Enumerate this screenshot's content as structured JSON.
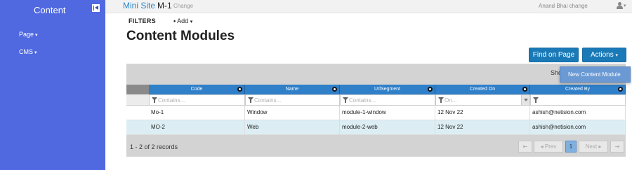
{
  "sidebar": {
    "title": "Content",
    "items": [
      {
        "label": "Page"
      },
      {
        "label": "CMS"
      }
    ]
  },
  "topbar": {
    "site_label": "Mini Site",
    "site_name": "M-1",
    "change_label": "Change",
    "user_label": "Anand Bhai change"
  },
  "filters": {
    "label": "FILTERS",
    "add_label": "Add"
  },
  "main": {
    "title": "Content Modules",
    "find_button": "Find on Page",
    "actions_button": "Actions",
    "actions_menu": [
      {
        "label": "New Content Module"
      }
    ]
  },
  "grid": {
    "toolbar_text": "Sho",
    "columns": [
      "Code",
      "Name",
      "UrlSegment",
      "Created On",
      "Created By"
    ],
    "filter_placeholders": [
      "Contains...",
      "Contains...",
      "Contains...",
      "On...",
      ""
    ],
    "rows": [
      [
        "Mo-1",
        "Window",
        "module-1-window",
        "12 Nov 22",
        "ashish@netision.com"
      ],
      [
        "MO-2",
        "Web",
        "module-2-web",
        "12 Nov 22",
        "ashish@netision.com"
      ]
    ],
    "pager": {
      "info": "1 - 2 of 2 records",
      "first": "⇤",
      "prev": "Prev",
      "current": "1",
      "next": "Next",
      "last": "⇥"
    }
  }
}
